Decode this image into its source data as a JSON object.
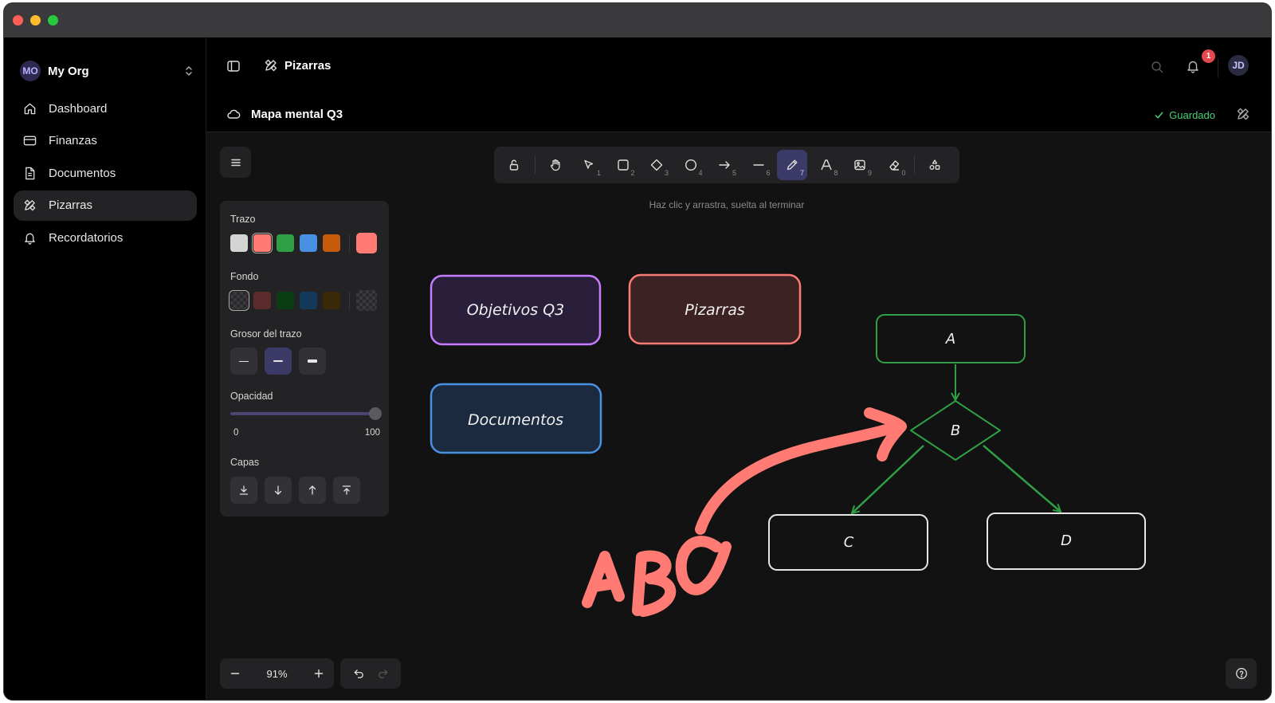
{
  "org": {
    "initials": "MO",
    "name": "My Org"
  },
  "sidebar": {
    "items": [
      {
        "label": "Dashboard",
        "icon": "home-icon",
        "active": false
      },
      {
        "label": "Finanzas",
        "icon": "card-icon",
        "active": false
      },
      {
        "label": "Documentos",
        "icon": "document-icon",
        "active": false
      },
      {
        "label": "Pizarras",
        "icon": "pencil-ruler-icon",
        "active": true
      },
      {
        "label": "Recordatorios",
        "icon": "bell-icon",
        "active": false
      }
    ]
  },
  "header": {
    "title": "Pizarras",
    "notifications": "1",
    "user_initials": "JD"
  },
  "document": {
    "title": "Mapa mental Q3",
    "status": "Guardado"
  },
  "toolbar": {
    "tools": [
      {
        "name": "lock",
        "key": ""
      },
      {
        "name": "hand",
        "key": ""
      },
      {
        "name": "selection",
        "key": "1"
      },
      {
        "name": "rectangle",
        "key": "2"
      },
      {
        "name": "diamond",
        "key": "3"
      },
      {
        "name": "ellipse",
        "key": "4"
      },
      {
        "name": "arrow",
        "key": "5"
      },
      {
        "name": "line",
        "key": "6"
      },
      {
        "name": "draw",
        "key": "7"
      },
      {
        "name": "text",
        "key": "8"
      },
      {
        "name": "image",
        "key": "9"
      },
      {
        "name": "eraser",
        "key": "0"
      },
      {
        "name": "library",
        "key": ""
      }
    ],
    "active_tool": "draw",
    "hint": "Haz clic y arrastra, suelta al terminar"
  },
  "properties": {
    "stroke_label": "Trazo",
    "stroke_colors": [
      "#d4d4d4",
      "#ff7b74",
      "#2f9e44",
      "#4a90e2",
      "#c65c0b"
    ],
    "stroke_selected": "#ff7b74",
    "background_label": "Fondo",
    "background_colors": [
      "transparent",
      "#5c2b2b",
      "#0b3d12",
      "#133a5a",
      "#3b2a08"
    ],
    "stroke_width_label": "Grosor del trazo",
    "opacity_label": "Opacidad",
    "opacity_min": "0",
    "opacity_max": "100",
    "opacity_value": 100,
    "layers_label": "Capas"
  },
  "zoom": {
    "value": "91%"
  },
  "canvas": {
    "nodes": [
      {
        "label": "Objetivos Q3",
        "stroke": "#c77dff",
        "fill": "#2a1f3a"
      },
      {
        "label": "Pizarras",
        "stroke": "#ff7b74",
        "fill": "#3d2224"
      },
      {
        "label": "Documentos",
        "stroke": "#4a90e2",
        "fill": "#1c2a40"
      },
      {
        "label": "A",
        "stroke": "#2f9e44",
        "fill": "none"
      },
      {
        "label": "B",
        "stroke": "#2f9e44",
        "fill": "none"
      },
      {
        "label": "C",
        "stroke": "#e6e6e6",
        "fill": "none"
      },
      {
        "label": "D",
        "stroke": "#e6e6e6",
        "fill": "none"
      }
    ],
    "freehand_text": "ABC",
    "freehand_color": "#ff7b74"
  }
}
